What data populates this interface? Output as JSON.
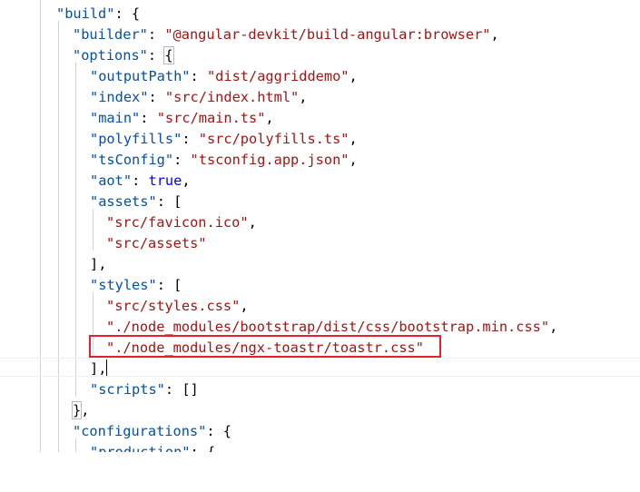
{
  "code": {
    "build_key": "\"build\"",
    "builder_key": "\"builder\"",
    "builder_value": "\"@angular-devkit/build-angular:browser\"",
    "options_key": "\"options\"",
    "outputPath_key": "\"outputPath\"",
    "outputPath_value": "\"dist/aggriddemo\"",
    "index_key": "\"index\"",
    "index_value": "\"src/index.html\"",
    "main_key": "\"main\"",
    "main_value": "\"src/main.ts\"",
    "polyfills_key": "\"polyfills\"",
    "polyfills_value": "\"src/polyfills.ts\"",
    "tsConfig_key": "\"tsConfig\"",
    "tsConfig_value": "\"tsconfig.app.json\"",
    "aot_key": "\"aot\"",
    "aot_value": "true",
    "assets_key": "\"assets\"",
    "asset_favicon": "\"src/favicon.ico\"",
    "asset_assets": "\"src/assets\"",
    "styles_key": "\"styles\"",
    "style_styles_css": "\"src/styles.css\"",
    "style_bootstrap": "\"./node_modules/bootstrap/dist/css/bootstrap.min.css\"",
    "style_toastr": "\"./node_modules/ngx-toastr/toastr.css\"",
    "scripts_key": "\"scripts\"",
    "scripts_value": "[]",
    "configurations_key": "\"configurations\"",
    "production_key": "\"production\""
  },
  "colors": {
    "key": "#0451a5",
    "string": "#a31515",
    "boolean": "#0000ff",
    "highlight_box": "#e4222d"
  }
}
